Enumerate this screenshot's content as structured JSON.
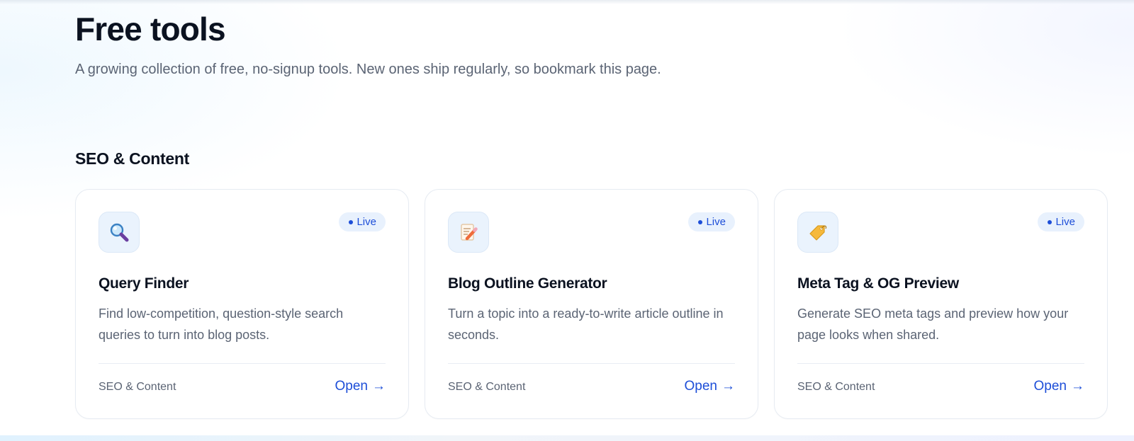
{
  "header": {
    "title": "Free tools",
    "subtitle": "A growing collection of free, no-signup tools. New ones ship regularly, so bookmark this page."
  },
  "section": {
    "title": "SEO & Content"
  },
  "cards": [
    {
      "icon": "magnifying-glass-icon",
      "status": "Live",
      "title": "Query Finder",
      "description": "Find low-competition, question-style search queries to turn into blog posts.",
      "category": "SEO & Content",
      "open_label": "Open",
      "open_arrow": "→"
    },
    {
      "icon": "memo-pencil-icon",
      "status": "Live",
      "title": "Blog Outline Generator",
      "description": "Turn a topic into a ready-to-write article outline in seconds.",
      "category": "SEO & Content",
      "open_label": "Open",
      "open_arrow": "→"
    },
    {
      "icon": "label-tag-icon",
      "status": "Live",
      "title": "Meta Tag & OG Preview",
      "description": "Generate SEO meta tags and preview how your page looks when shared.",
      "category": "SEO & Content",
      "open_label": "Open",
      "open_arrow": "→"
    }
  ],
  "colors": {
    "accent": "#1d4ed8",
    "badge_bg": "#e8f1fd",
    "icon_tile_bg": "#eaf3fd",
    "text_primary": "#0b1220",
    "text_muted": "#5b6474"
  }
}
